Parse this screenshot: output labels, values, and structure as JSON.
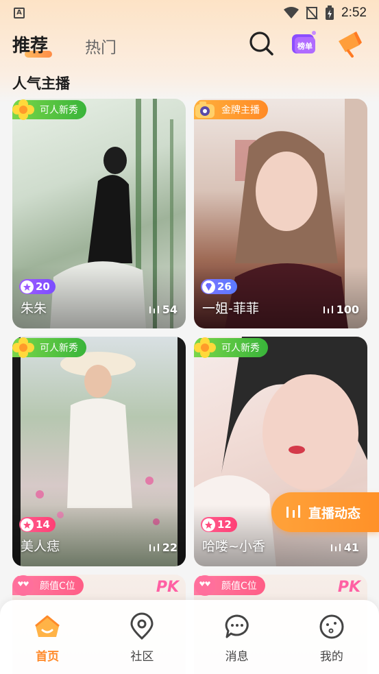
{
  "status_bar": {
    "time": "2:52",
    "notification_letter": "A"
  },
  "tabs": {
    "active": "推荐",
    "inactive": "热门"
  },
  "header_icons": {
    "rank_badge_label": "榜单"
  },
  "section_title": "人气主播",
  "cards": [
    {
      "tag": "可人新秀",
      "tag_style": "green",
      "level": "20",
      "level_style": "purple",
      "name": "朱朱",
      "viewers": "54"
    },
    {
      "tag": "金牌主播",
      "tag_style": "orange",
      "level": "26",
      "level_style": "blue",
      "name": "一姐-菲菲",
      "viewers": "100"
    },
    {
      "tag": "可人新秀",
      "tag_style": "green",
      "level": "14",
      "level_style": "pink",
      "name": "美人痣",
      "viewers": "22"
    },
    {
      "tag": "可人新秀",
      "tag_style": "green",
      "level": "12",
      "level_style": "pink",
      "name": "哈喽~小香",
      "viewers": "41"
    },
    {
      "tag": "颜值C位",
      "tag_style": "pink",
      "badge": "PK"
    },
    {
      "tag": "颜值C位",
      "tag_style": "pink",
      "badge": "PK"
    }
  ],
  "floating_button": {
    "label": "直播动态"
  },
  "bottom_nav": [
    {
      "label": "首页",
      "icon": "home-icon",
      "active": true
    },
    {
      "label": "社区",
      "icon": "community-icon",
      "active": false
    },
    {
      "label": "消息",
      "icon": "message-icon",
      "active": false
    },
    {
      "label": "我的",
      "icon": "profile-icon",
      "active": false
    }
  ],
  "colors": {
    "accent": "#ff8a2a",
    "tag_green": "#39b43a",
    "tag_orange": "#ff8a26",
    "tag_pink": "#ff5d86"
  }
}
